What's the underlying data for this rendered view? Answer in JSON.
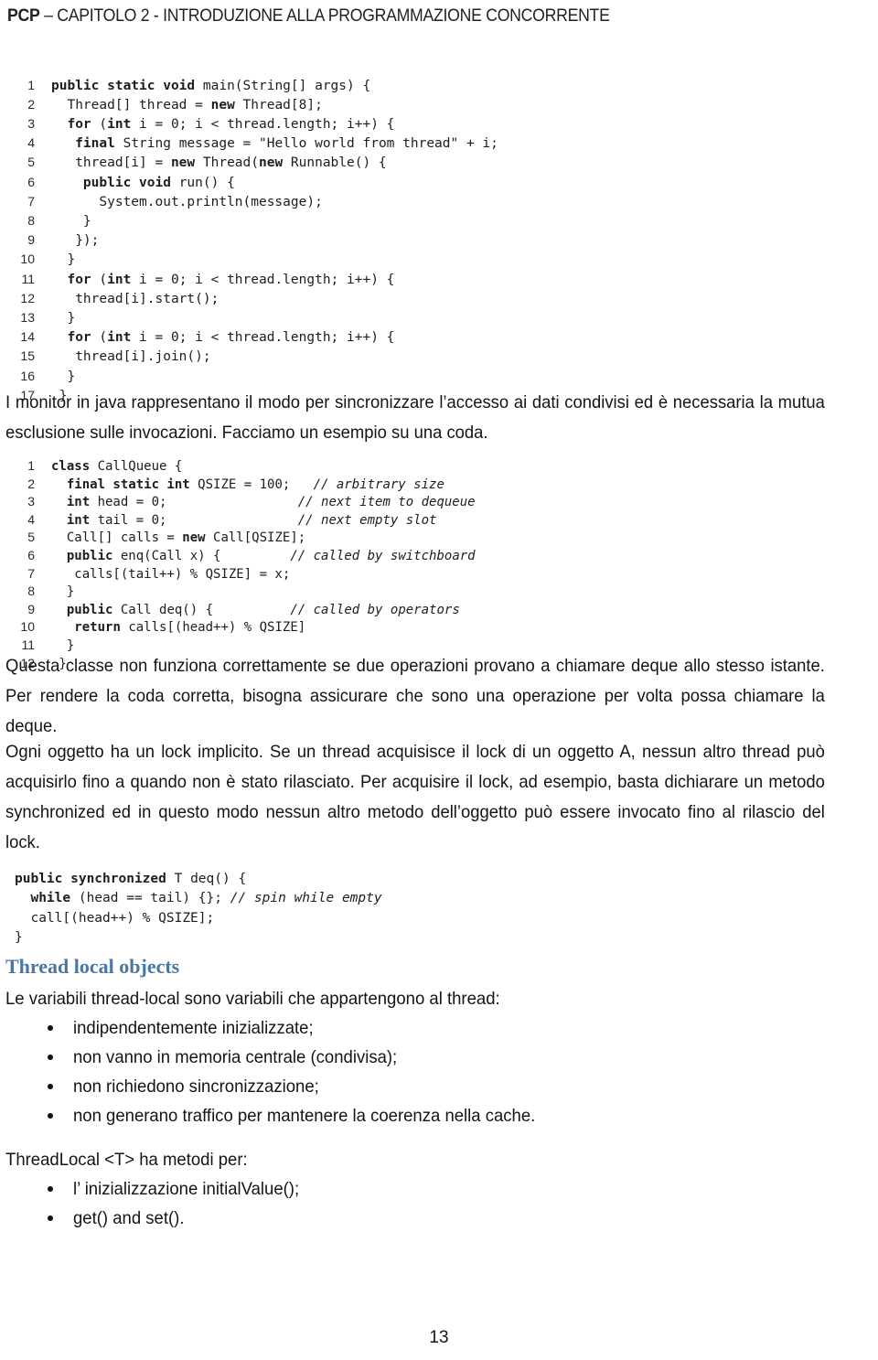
{
  "document": {
    "header": {
      "prefix": "PCP",
      "rest": " – CAPITOLO 2 - INTRODUZIONE ALLA PROGRAMMAZIONE CONCORRENTE"
    },
    "page_number": "13",
    "accent_color": "#4a76a0",
    "text_color": "#141414"
  },
  "code_blocks": [
    {
      "name": "main-thread-example",
      "show_line_numbers": true,
      "lines": [
        {
          "n": "1",
          "segments": [
            {
              "t": "public static void ",
              "bold": true
            },
            {
              "t": "main(String[] args) {"
            }
          ]
        },
        {
          "n": "2",
          "segments": [
            {
              "t": "  Thread[] thread = "
            },
            {
              "t": "new ",
              "bold": true
            },
            {
              "t": "Thread[8];"
            }
          ]
        },
        {
          "n": "3",
          "segments": [
            {
              "t": "  "
            },
            {
              "t": "for ",
              "bold": true
            },
            {
              "t": "("
            },
            {
              "t": "int ",
              "bold": true
            },
            {
              "t": "i = 0; i < thread.length; i++) {"
            }
          ]
        },
        {
          "n": "4",
          "segments": [
            {
              "t": "   "
            },
            {
              "t": "final ",
              "bold": true
            },
            {
              "t": "String message = \"Hello world from thread\" + i;"
            }
          ]
        },
        {
          "n": "5",
          "segments": [
            {
              "t": "   thread[i] = "
            },
            {
              "t": "new ",
              "bold": true
            },
            {
              "t": "Thread("
            },
            {
              "t": "new ",
              "bold": true
            },
            {
              "t": "Runnable() {"
            }
          ]
        },
        {
          "n": "6",
          "segments": [
            {
              "t": "    "
            },
            {
              "t": "public void ",
              "bold": true
            },
            {
              "t": "run() {"
            }
          ]
        },
        {
          "n": "7",
          "segments": [
            {
              "t": "      System.out.println(message);"
            }
          ]
        },
        {
          "n": "8",
          "segments": [
            {
              "t": "    }"
            }
          ]
        },
        {
          "n": "9",
          "segments": [
            {
              "t": "   });"
            }
          ]
        },
        {
          "n": "10",
          "segments": [
            {
              "t": "  }"
            }
          ]
        },
        {
          "n": "11",
          "segments": [
            {
              "t": "  "
            },
            {
              "t": "for ",
              "bold": true
            },
            {
              "t": "("
            },
            {
              "t": "int ",
              "bold": true
            },
            {
              "t": "i = 0; i < thread.length; i++) {"
            }
          ]
        },
        {
          "n": "12",
          "segments": [
            {
              "t": "   thread[i].start();"
            }
          ]
        },
        {
          "n": "13",
          "segments": [
            {
              "t": "  }"
            }
          ]
        },
        {
          "n": "14",
          "segments": [
            {
              "t": "  "
            },
            {
              "t": "for ",
              "bold": true
            },
            {
              "t": "("
            },
            {
              "t": "int ",
              "bold": true
            },
            {
              "t": "i = 0; i < thread.length; i++) {"
            }
          ]
        },
        {
          "n": "15",
          "segments": [
            {
              "t": "   thread[i].join();"
            }
          ]
        },
        {
          "n": "16",
          "segments": [
            {
              "t": "  }"
            }
          ]
        },
        {
          "n": "17",
          "segments": [
            {
              "t": " }"
            }
          ]
        }
      ]
    },
    {
      "name": "callqueue-class",
      "show_line_numbers": true,
      "lines": [
        {
          "n": "1",
          "segments": [
            {
              "t": "class ",
              "bold": true
            },
            {
              "t": "CallQueue {"
            }
          ]
        },
        {
          "n": "2",
          "segments": [
            {
              "t": "  "
            },
            {
              "t": "final static int ",
              "bold": true
            },
            {
              "t": "QSIZE = 100;   "
            },
            {
              "t": "// arbitrary size",
              "italic": true
            }
          ]
        },
        {
          "n": "3",
          "segments": [
            {
              "t": "  "
            },
            {
              "t": "int ",
              "bold": true
            },
            {
              "t": "head = 0;                 "
            },
            {
              "t": "// next item to dequeue",
              "italic": true
            }
          ]
        },
        {
          "n": "4",
          "segments": [
            {
              "t": "  "
            },
            {
              "t": "int ",
              "bold": true
            },
            {
              "t": "tail = 0;                 "
            },
            {
              "t": "// next empty slot",
              "italic": true
            }
          ]
        },
        {
          "n": "5",
          "segments": [
            {
              "t": "  Call[] calls = "
            },
            {
              "t": "new ",
              "bold": true
            },
            {
              "t": "Call[QSIZE];"
            }
          ]
        },
        {
          "n": "6",
          "segments": [
            {
              "t": "  "
            },
            {
              "t": "public ",
              "bold": true
            },
            {
              "t": "enq(Call x) {         "
            },
            {
              "t": "// called by switchboard",
              "italic": true
            }
          ]
        },
        {
          "n": "7",
          "segments": [
            {
              "t": "   calls[(tail++) % QSIZE] = x;"
            }
          ]
        },
        {
          "n": "8",
          "segments": [
            {
              "t": "  }"
            }
          ]
        },
        {
          "n": "9",
          "segments": [
            {
              "t": "  "
            },
            {
              "t": "public ",
              "bold": true
            },
            {
              "t": "Call deq() {          "
            },
            {
              "t": "// called by operators",
              "italic": true
            }
          ]
        },
        {
          "n": "10",
          "segments": [
            {
              "t": "   "
            },
            {
              "t": "return ",
              "bold": true
            },
            {
              "t": "calls[(head++) % QSIZE]"
            }
          ]
        },
        {
          "n": "11",
          "segments": [
            {
              "t": "  }"
            }
          ]
        },
        {
          "n": "12",
          "segments": [
            {
              "t": " }"
            }
          ]
        }
      ]
    },
    {
      "name": "synchronized-deq",
      "show_line_numbers": false,
      "lines": [
        {
          "n": "",
          "segments": [
            {
              "t": "public synchronized ",
              "bold": true
            },
            {
              "t": "T deq() {"
            }
          ]
        },
        {
          "n": "",
          "segments": [
            {
              "t": "  "
            },
            {
              "t": "while ",
              "bold": true
            },
            {
              "t": "(head == tail) {}; "
            },
            {
              "t": "// spin while empty",
              "italic": true
            }
          ]
        },
        {
          "n": "",
          "segments": [
            {
              "t": "  call[(head++) % QSIZE];"
            }
          ]
        },
        {
          "n": "",
          "segments": [
            {
              "t": "}"
            }
          ]
        }
      ]
    }
  ],
  "paragraphs": {
    "monitor": "I monitor in java rappresentano il modo per sincronizzare l’accesso ai dati condivisi ed è necessaria la mutua esclusione sulle invocazioni. Facciamo un esempio su una coda.",
    "queue": "Questa classe non funziona correttamente se due operazioni provano a chiamare deque allo stesso istante. Per rendere la coda corretta, bisogna assicurare che sono una operazione per volta possa chiamare la deque.",
    "lock": "Ogni oggetto ha un lock implicito. Se un thread acquisisce il lock di un oggetto A, nessun altro thread può acquisirlo fino a  quando non è stato rilasciato. Per acquisire il lock, ad esempio, basta dichiarare un metodo synchronized ed in questo modo nessun altro metodo dell’oggetto può essere invocato fino al rilascio del lock."
  },
  "thread_local_section": {
    "heading": "Thread local objects",
    "lead_vars": "Le variabili thread-local sono variabili che appartengono al thread:",
    "bullets_vars": [
      "indipendentemente inizializzate;",
      "non vanno in memoria centrale (condivisa);",
      "non richiedono sincronizzazione;",
      "non generano traffico per mantenere la coerenza nella cache."
    ],
    "lead_api": "ThreadLocal <T> ha metodi per:",
    "bullets_api": [
      "l’ inizializzazione initialValue();",
      "get() and set()."
    ]
  }
}
